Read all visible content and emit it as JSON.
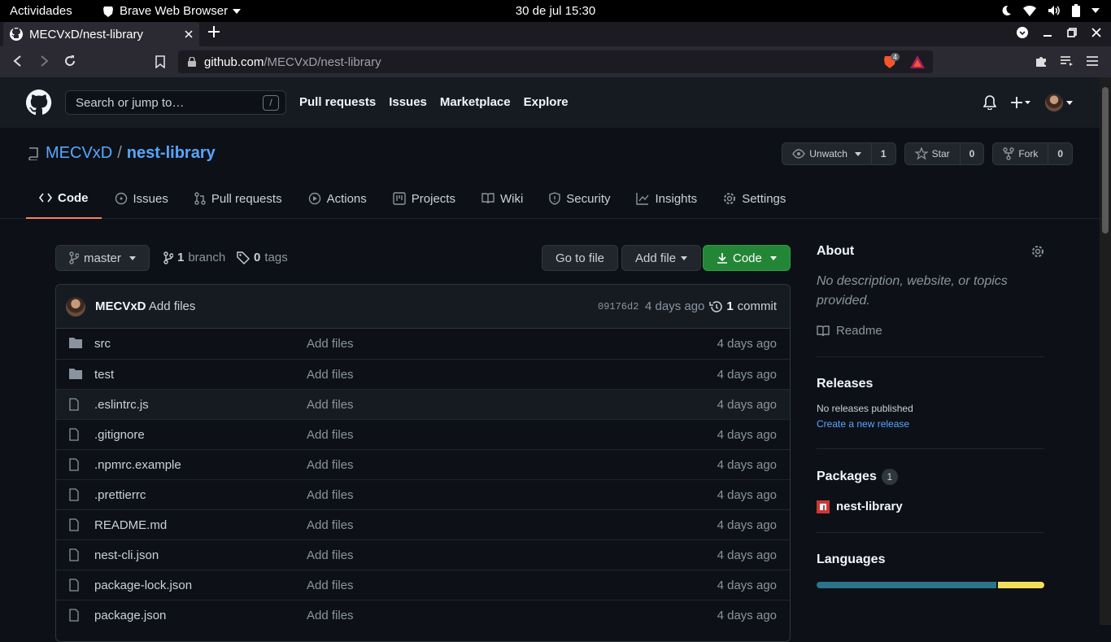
{
  "os": {
    "activities": "Actividades",
    "app_name": "Brave Web Browser",
    "clock": "30 de jul  15:30"
  },
  "browser": {
    "tab_title": "MECVxD/nest-library",
    "url_host": "github.com",
    "url_path": "/MECVxD/nest-library",
    "shield_count": "4"
  },
  "gh": {
    "search_placeholder": "Search or jump to…",
    "search_key": "/",
    "nav": [
      "Pull requests",
      "Issues",
      "Marketplace",
      "Explore"
    ]
  },
  "repo": {
    "owner": "MECVxD",
    "separator": "/",
    "name": "nest-library",
    "watch_label": "Unwatch",
    "watch_count": "1",
    "star_label": "Star",
    "star_count": "0",
    "fork_label": "Fork",
    "fork_count": "0",
    "tabs": [
      "Code",
      "Issues",
      "Pull requests",
      "Actions",
      "Projects",
      "Wiki",
      "Security",
      "Insights",
      "Settings"
    ]
  },
  "main": {
    "branch": "master",
    "branch_count": "1",
    "branch_word": "branch",
    "tag_count": "0",
    "tag_word": "tags",
    "go_to_file": "Go to file",
    "add_file": "Add file",
    "code_button": "Code",
    "commit_author": "MECVxD",
    "commit_message": "Add files",
    "commit_sha": "09176d2",
    "commit_age": "4 days ago",
    "commit_count": "1",
    "commit_word": "commit",
    "files": [
      {
        "name": "src",
        "type": "dir",
        "msg": "Add files",
        "age": "4 days ago"
      },
      {
        "name": "test",
        "type": "dir",
        "msg": "Add files",
        "age": "4 days ago"
      },
      {
        "name": ".eslintrc.js",
        "type": "file",
        "msg": "Add files",
        "age": "4 days ago"
      },
      {
        "name": ".gitignore",
        "type": "file",
        "msg": "Add files",
        "age": "4 days ago"
      },
      {
        "name": ".npmrc.example",
        "type": "file",
        "msg": "Add files",
        "age": "4 days ago"
      },
      {
        "name": ".prettierrc",
        "type": "file",
        "msg": "Add files",
        "age": "4 days ago"
      },
      {
        "name": "README.md",
        "type": "file",
        "msg": "Add files",
        "age": "4 days ago"
      },
      {
        "name": "nest-cli.json",
        "type": "file",
        "msg": "Add files",
        "age": "4 days ago"
      },
      {
        "name": "package-lock.json",
        "type": "file",
        "msg": "Add files",
        "age": "4 days ago"
      },
      {
        "name": "package.json",
        "type": "file",
        "msg": "Add files",
        "age": "4 days ago"
      }
    ]
  },
  "sidebar": {
    "about_title": "About",
    "about_desc": "No description, website, or topics provided.",
    "readme": "Readme",
    "releases_title": "Releases",
    "no_releases": "No releases published",
    "create_release": "Create a new release",
    "packages_title": "Packages",
    "packages_count": "1",
    "package_name": "nest-library",
    "languages_title": "Languages"
  },
  "colors": {
    "accent_link": "#58a6ff",
    "green_button": "#238636",
    "tab_underline": "#f78166",
    "lang_typescript": "#2b7489",
    "lang_javascript": "#f1e05a"
  }
}
